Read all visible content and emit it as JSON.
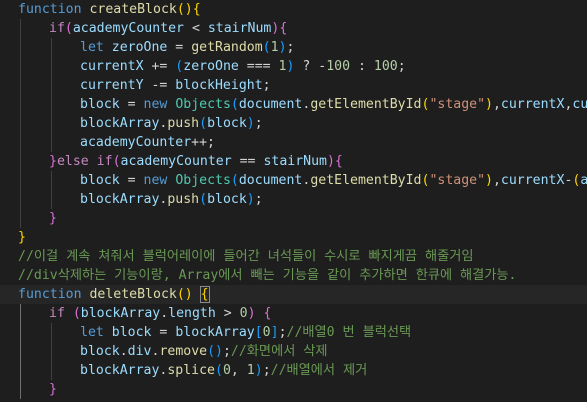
{
  "editor": {
    "theme_colors": {
      "background": "#1e1e1e",
      "keyword": "#569cd6",
      "control": "#c586c0",
      "function": "#dcdcaa",
      "variable": "#9cdcfe",
      "number": "#b5cea8",
      "string": "#ce9178",
      "class": "#4ec9b0",
      "comment": "#6a9955",
      "bracket_level1": "#ffd700",
      "bracket_level2": "#da70d6",
      "bracket_level3": "#179fff"
    },
    "lines": [
      {
        "indent": 0,
        "guides": [],
        "tokens": [
          [
            "kw",
            "function"
          ],
          [
            "op",
            " "
          ],
          [
            "fn",
            "createBlock"
          ],
          [
            "b1",
            "()"
          ],
          [
            "b1",
            "{"
          ]
        ]
      },
      {
        "indent": 1,
        "guides": [
          0
        ],
        "tokens": [
          [
            "ctl",
            "if"
          ],
          [
            "b2",
            "("
          ],
          [
            "var",
            "academyCounter"
          ],
          [
            "op",
            " < "
          ],
          [
            "var",
            "stairNum"
          ],
          [
            "b2",
            ")"
          ],
          [
            "b2",
            "{"
          ]
        ]
      },
      {
        "indent": 2,
        "guides": [
          0,
          1
        ],
        "tokens": [
          [
            "kw",
            "let"
          ],
          [
            "op",
            " "
          ],
          [
            "var",
            "zeroOne"
          ],
          [
            "op",
            " = "
          ],
          [
            "fn",
            "getRandom"
          ],
          [
            "b3",
            "("
          ],
          [
            "num",
            "1"
          ],
          [
            "b3",
            ")"
          ],
          [
            "op",
            ";"
          ]
        ]
      },
      {
        "indent": 2,
        "guides": [
          0,
          1
        ],
        "tokens": [
          [
            "var",
            "currentX"
          ],
          [
            "op",
            " += "
          ],
          [
            "b3",
            "("
          ],
          [
            "var",
            "zeroOne"
          ],
          [
            "op",
            " === "
          ],
          [
            "num",
            "1"
          ],
          [
            "b3",
            ")"
          ],
          [
            "op",
            " ? "
          ],
          [
            "op",
            "-"
          ],
          [
            "num",
            "100"
          ],
          [
            "op",
            " : "
          ],
          [
            "num",
            "100"
          ],
          [
            "op",
            ";"
          ]
        ]
      },
      {
        "indent": 2,
        "guides": [
          0,
          1
        ],
        "tokens": [
          [
            "var",
            "currentY"
          ],
          [
            "op",
            " -= "
          ],
          [
            "var",
            "blockHeight"
          ],
          [
            "op",
            ";"
          ]
        ]
      },
      {
        "indent": 2,
        "guides": [
          0,
          1
        ],
        "tokens": [
          [
            "var",
            "block"
          ],
          [
            "op",
            " = "
          ],
          [
            "kw",
            "new"
          ],
          [
            "op",
            " "
          ],
          [
            "cls",
            "Objects"
          ],
          [
            "b3",
            "("
          ],
          [
            "var",
            "document"
          ],
          [
            "op",
            "."
          ],
          [
            "fn",
            "getElementById"
          ],
          [
            "b1",
            "("
          ],
          [
            "str",
            "\"stage\""
          ],
          [
            "b1",
            ")"
          ],
          [
            "op",
            ","
          ],
          [
            "var",
            "currentX"
          ],
          [
            "op",
            ","
          ],
          [
            "var",
            "currentY"
          ],
          [
            "op",
            ","
          ]
        ]
      },
      {
        "indent": 2,
        "guides": [
          0,
          1
        ],
        "tokens": [
          [
            "var",
            "blockArray"
          ],
          [
            "op",
            "."
          ],
          [
            "fn",
            "push"
          ],
          [
            "b3",
            "("
          ],
          [
            "var",
            "block"
          ],
          [
            "b3",
            ")"
          ],
          [
            "op",
            ";"
          ]
        ]
      },
      {
        "indent": 2,
        "guides": [
          0,
          1
        ],
        "tokens": [
          [
            "var",
            "academyCounter"
          ],
          [
            "op",
            "++;"
          ]
        ]
      },
      {
        "indent": 1,
        "guides": [
          0
        ],
        "tokens": [
          [
            "b2",
            "}"
          ],
          [
            "ctl",
            "else"
          ],
          [
            "op",
            " "
          ],
          [
            "ctl",
            "if"
          ],
          [
            "b2",
            "("
          ],
          [
            "var",
            "academyCounter"
          ],
          [
            "op",
            " == "
          ],
          [
            "var",
            "stairNum"
          ],
          [
            "b2",
            ")"
          ],
          [
            "b2",
            "{"
          ]
        ]
      },
      {
        "indent": 2,
        "guides": [
          0,
          1
        ],
        "tokens": [
          [
            "var",
            "block"
          ],
          [
            "op",
            " = "
          ],
          [
            "kw",
            "new"
          ],
          [
            "op",
            " "
          ],
          [
            "cls",
            "Objects"
          ],
          [
            "b3",
            "("
          ],
          [
            "var",
            "document"
          ],
          [
            "op",
            "."
          ],
          [
            "fn",
            "getElementById"
          ],
          [
            "b1",
            "("
          ],
          [
            "str",
            "\"stage\""
          ],
          [
            "b1",
            ")"
          ],
          [
            "op",
            ","
          ],
          [
            "var",
            "currentX"
          ],
          [
            "op",
            "-"
          ],
          [
            "b1",
            "("
          ],
          [
            "var",
            "academyCounter"
          ]
        ]
      },
      {
        "indent": 2,
        "guides": [
          0,
          1
        ],
        "tokens": [
          [
            "var",
            "blockArray"
          ],
          [
            "op",
            "."
          ],
          [
            "fn",
            "push"
          ],
          [
            "b3",
            "("
          ],
          [
            "var",
            "block"
          ],
          [
            "b3",
            ")"
          ],
          [
            "op",
            ";"
          ]
        ]
      },
      {
        "indent": 1,
        "guides": [
          0
        ],
        "tokens": [
          [
            "b2",
            "}"
          ]
        ]
      },
      {
        "indent": 0,
        "guides": [],
        "tokens": [
          [
            "b1",
            "}"
          ]
        ]
      },
      {
        "indent": 0,
        "guides": [],
        "tokens": [
          [
            "cmt",
            "//이걸 계속 쳐줘서 블럭어레이에 들어간 녀석들이 수시로 빠지게끔 해줄거임"
          ]
        ]
      },
      {
        "indent": 0,
        "guides": [],
        "tokens": [
          [
            "cmt",
            "//div삭제하는 기능이랑, Array에서 빼는 기능을 같이 추가하면 한큐에 해결가능."
          ]
        ]
      },
      {
        "indent": 0,
        "guides": [],
        "highlight": true,
        "tokens": [
          [
            "kw",
            "function"
          ],
          [
            "op",
            " "
          ],
          [
            "fn",
            "deleteBlock"
          ],
          [
            "b1",
            "()"
          ],
          [
            "op",
            " "
          ],
          [
            "b1",
            "{",
            "cursor"
          ]
        ]
      },
      {
        "indent": 1,
        "guides": [
          0
        ],
        "guideActive": true,
        "tokens": [
          [
            "ctl",
            "if"
          ],
          [
            "op",
            " "
          ],
          [
            "b2",
            "("
          ],
          [
            "var",
            "blockArray"
          ],
          [
            "op",
            "."
          ],
          [
            "var",
            "length"
          ],
          [
            "op",
            " > "
          ],
          [
            "num",
            "0"
          ],
          [
            "b2",
            ")"
          ],
          [
            "op",
            " "
          ],
          [
            "b2",
            "{"
          ]
        ]
      },
      {
        "indent": 2,
        "guides": [
          0,
          1
        ],
        "guideActive": true,
        "tokens": [
          [
            "kw",
            "let"
          ],
          [
            "op",
            " "
          ],
          [
            "var",
            "block"
          ],
          [
            "op",
            " = "
          ],
          [
            "var",
            "blockArray"
          ],
          [
            "b3",
            "["
          ],
          [
            "num",
            "0"
          ],
          [
            "b3",
            "]"
          ],
          [
            "op",
            ";"
          ],
          [
            "cmt",
            "//배열0 번 블럭선택"
          ]
        ]
      },
      {
        "indent": 2,
        "guides": [
          0,
          1
        ],
        "guideActive": true,
        "tokens": [
          [
            "var",
            "block"
          ],
          [
            "op",
            "."
          ],
          [
            "var",
            "div"
          ],
          [
            "op",
            "."
          ],
          [
            "fn",
            "remove"
          ],
          [
            "b3",
            "()"
          ],
          [
            "op",
            ";"
          ],
          [
            "cmt",
            "//화면에서 삭제"
          ]
        ]
      },
      {
        "indent": 2,
        "guides": [
          0,
          1
        ],
        "guideActive": true,
        "tokens": [
          [
            "var",
            "blockArray"
          ],
          [
            "op",
            "."
          ],
          [
            "fn",
            "splice"
          ],
          [
            "b3",
            "("
          ],
          [
            "num",
            "0"
          ],
          [
            "op",
            ", "
          ],
          [
            "num",
            "1"
          ],
          [
            "b3",
            ")"
          ],
          [
            "op",
            ";"
          ],
          [
            "cmt",
            "//배열에서 제거"
          ]
        ]
      },
      {
        "indent": 1,
        "guides": [
          0
        ],
        "guideActive": true,
        "tokens": [
          [
            "b2",
            "}"
          ]
        ]
      }
    ]
  }
}
